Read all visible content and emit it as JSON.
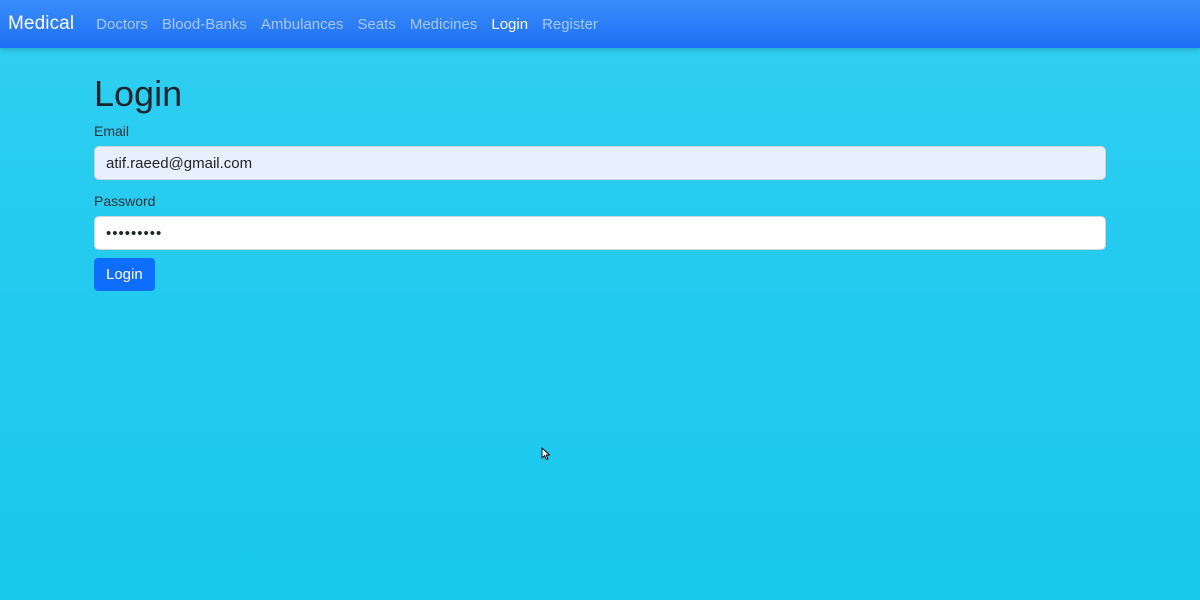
{
  "navbar": {
    "brand": "Medical",
    "links": [
      {
        "label": "Doctors"
      },
      {
        "label": "Blood-Banks"
      },
      {
        "label": "Ambulances"
      },
      {
        "label": "Seats"
      },
      {
        "label": "Medicines"
      },
      {
        "label": "Login"
      },
      {
        "label": "Register"
      }
    ],
    "active": "Login"
  },
  "main": {
    "title": "Login",
    "email": {
      "label": "Email",
      "value": "atif.raeed@gmail.com"
    },
    "password": {
      "label": "Password",
      "value": "•••••••••"
    },
    "submit_label": "Login"
  },
  "colors": {
    "navbar": "#1e6ff5",
    "background": "#25cbef",
    "primary_button": "#0d6efd"
  },
  "icons": {
    "cursor": "mouse-pointer-icon"
  }
}
